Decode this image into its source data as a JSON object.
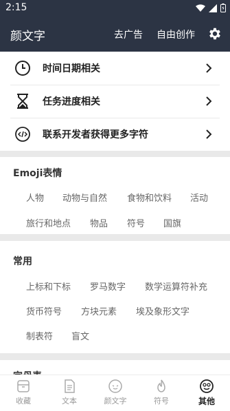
{
  "status_bar": {
    "time": "2:15"
  },
  "app_bar": {
    "title": "颜文字",
    "ad_label": "去广告",
    "free_create_label": "自由创作",
    "settings_icon": "gear-icon"
  },
  "quick_list": [
    {
      "label": "时间日期相关",
      "icon": "clock-icon"
    },
    {
      "label": "任务进度相关",
      "icon": "hourglass-icon"
    },
    {
      "label": "联系开发者获得更多字符",
      "icon": "code-icon"
    }
  ],
  "emoji_section": {
    "title": "Emoji表情",
    "tags": [
      "人物",
      "动物与自然",
      "食物和饮料",
      "活动",
      "旅行和地点",
      "物品",
      "符号",
      "国旗"
    ]
  },
  "common_section": {
    "title": "常用",
    "tags": [
      "上标和下标",
      "罗马数字",
      "数学运算符补充",
      "货币符号",
      "方块元素",
      "埃及象形文字",
      "制表符",
      "盲文"
    ]
  },
  "next_section": {
    "title": "字母表"
  },
  "bottom_nav": [
    {
      "label": "收藏",
      "icon": "archive-icon",
      "active": false
    },
    {
      "label": "文本",
      "icon": "document-icon",
      "active": false
    },
    {
      "label": "颜文字",
      "icon": "face-icon",
      "active": false
    },
    {
      "label": "符号",
      "icon": "flame-icon",
      "active": false
    },
    {
      "label": "其他",
      "icon": "smile-icon",
      "active": true
    }
  ],
  "colors": {
    "header_bg": "#2c3444",
    "page_bg": "#e9e9e9",
    "tag_text": "#666666"
  }
}
